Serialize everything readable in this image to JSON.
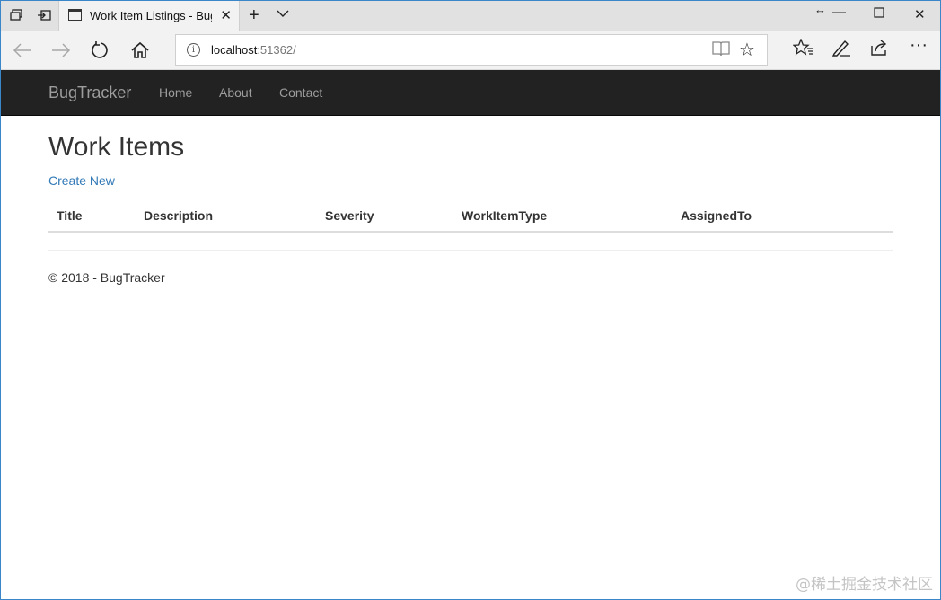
{
  "browser": {
    "tab": {
      "title": "Work Item Listings - Bug"
    },
    "address": {
      "host": "localhost",
      "port": ":51362/"
    }
  },
  "site": {
    "brand": "BugTracker",
    "nav": [
      {
        "label": "Home"
      },
      {
        "label": "About"
      },
      {
        "label": "Contact"
      }
    ]
  },
  "page": {
    "title": "Work Items",
    "create_label": "Create New",
    "columns": [
      "Title",
      "Description",
      "Severity",
      "WorkItemType",
      "AssignedTo"
    ],
    "rows": [],
    "footer": "© 2018 - BugTracker"
  },
  "watermark": "@稀土掘金技术社区",
  "colors": {
    "navbar_bg": "#222222",
    "nav_text": "#9d9d9d",
    "link": "#337ab7",
    "window_border": "#3a86c8"
  },
  "icons": {
    "tab_actions": [
      "tab-stack-icon",
      "set-aside-tabs-icon"
    ],
    "window": [
      "restore-arrows-icon",
      "minimize-icon",
      "maximize-icon",
      "close-icon"
    ],
    "nav": [
      "back-arrow-icon",
      "forward-arrow-icon",
      "refresh-icon",
      "home-icon"
    ],
    "address": [
      "info-icon",
      "reading-view-icon",
      "favorite-star-icon"
    ],
    "toolbar": [
      "favorites-hub-icon",
      "add-notes-icon",
      "share-icon",
      "more-icon"
    ]
  }
}
